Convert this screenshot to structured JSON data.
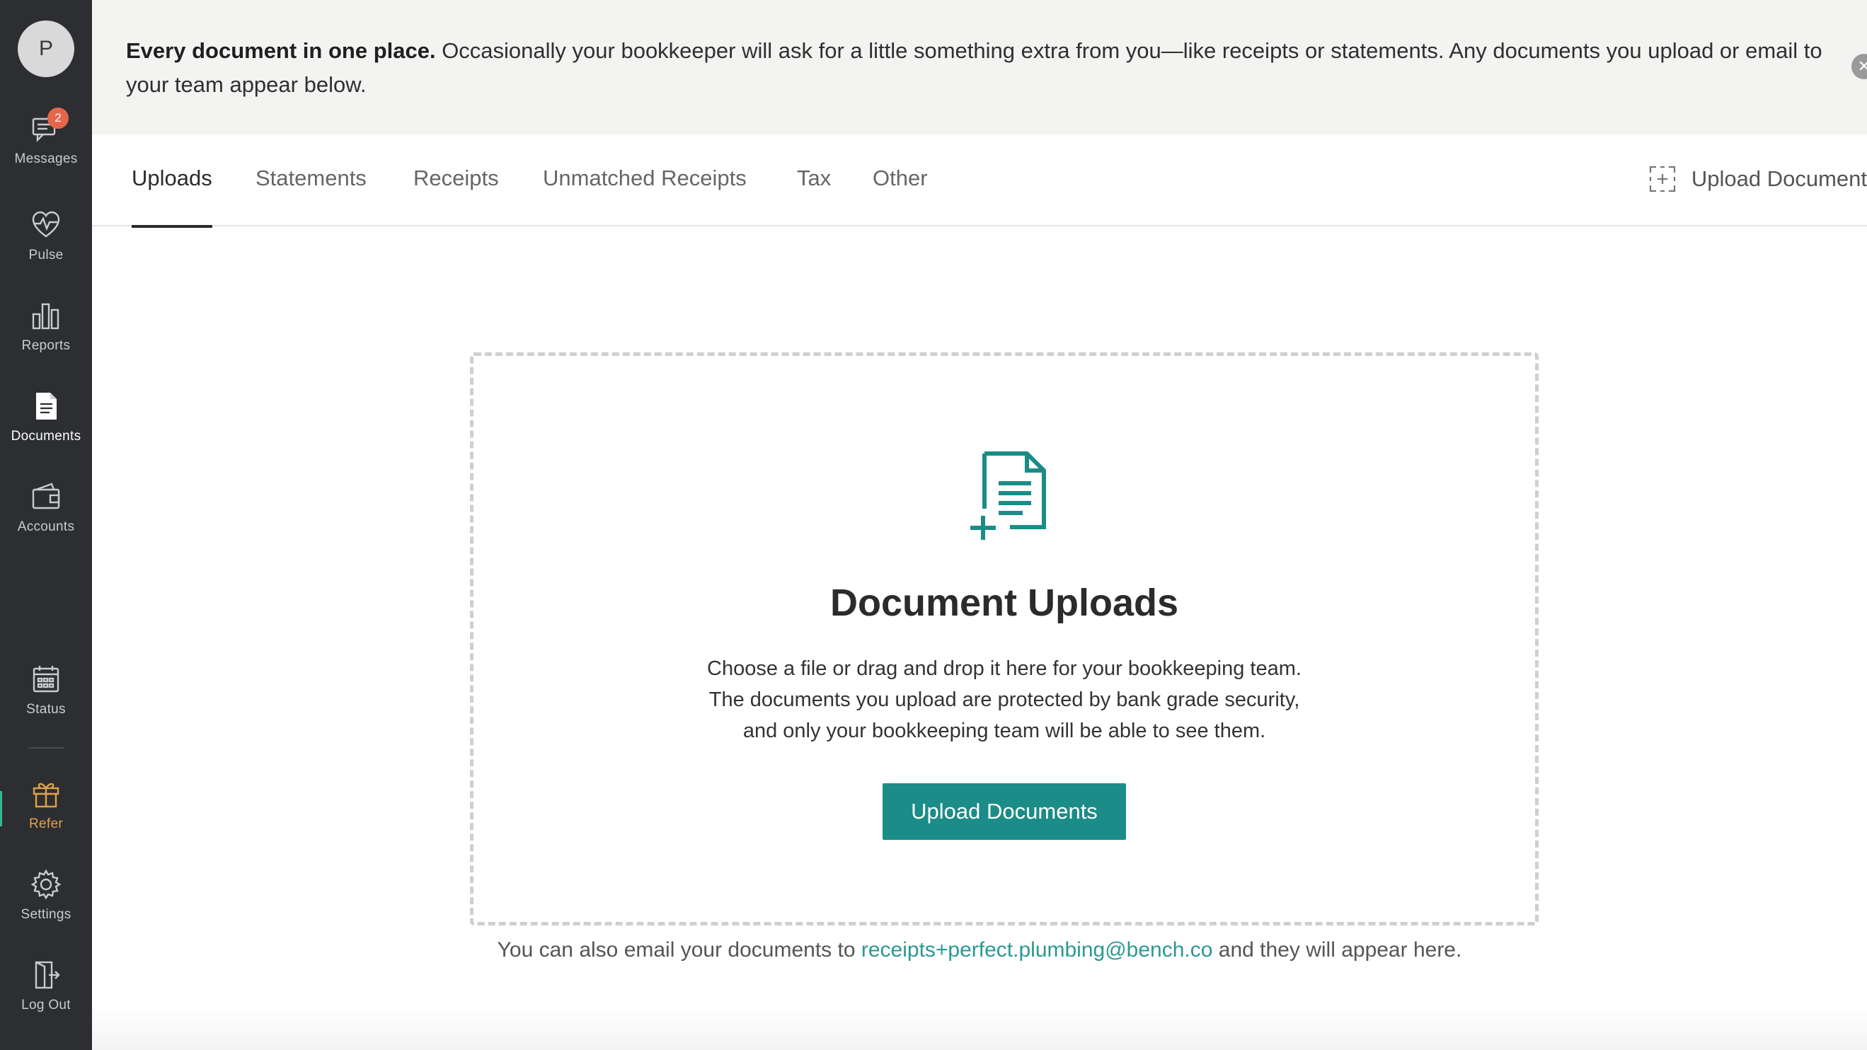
{
  "sidebar": {
    "avatar_initial": "P",
    "items": [
      {
        "label": "Messages",
        "badge": "2"
      },
      {
        "label": "Pulse"
      },
      {
        "label": "Reports"
      },
      {
        "label": "Documents",
        "active": true
      },
      {
        "label": "Accounts"
      },
      {
        "label": "Status"
      },
      {
        "label": "Refer"
      },
      {
        "label": "Settings"
      },
      {
        "label": "Log Out"
      }
    ]
  },
  "banner": {
    "bold": "Every document in one place.",
    "text": " Occasionally your bookkeeper will ask for a little something extra from you—like receipts or statements. Any documents you upload or email to your team appear below."
  },
  "tabs": [
    {
      "label": "Uploads",
      "active": true
    },
    {
      "label": "Statements"
    },
    {
      "label": "Receipts"
    },
    {
      "label": "Unmatched Receipts"
    },
    {
      "label": "Tax"
    },
    {
      "label": "Other"
    }
  ],
  "upload_link": "Upload Document",
  "dropzone": {
    "title": "Document Uploads",
    "line1": "Choose a file or drag and drop it here for your bookkeeping team.",
    "line2": "The documents you upload are protected by bank grade security,",
    "line3": "and only your bookkeeping team will be able to see them.",
    "button": "Upload Documents"
  },
  "email": {
    "prefix": "You can also email your documents to ",
    "address": "receipts+perfect.plumbing@bench.co",
    "suffix": " and they will appear here."
  },
  "colors": {
    "sidebar_bg": "#2c2e31",
    "accent_teal": "#1b8c87",
    "refer_gold": "#e1a14a",
    "badge_red": "#e5664a"
  }
}
